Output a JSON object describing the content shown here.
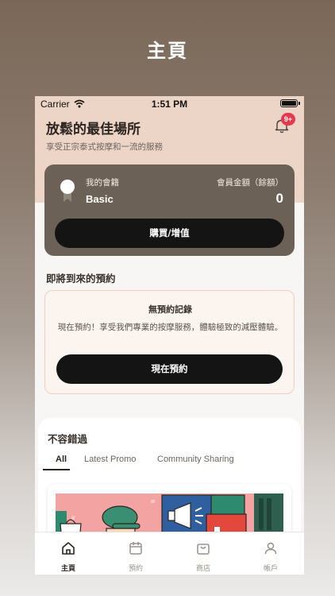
{
  "hero": {
    "title": "主頁"
  },
  "status_bar": {
    "carrier": "Carrier",
    "time": "1:51 PM"
  },
  "header": {
    "title": "放鬆的最佳場所",
    "subtitle": "享受正宗泰式按摩和一流的服務",
    "notification_badge": "9+"
  },
  "membership": {
    "label": "我的會籍",
    "tier": "Basic",
    "balance_label": "會員金額（餘額）",
    "balance_value": "0",
    "topup_button": "購買/增值"
  },
  "upcoming": {
    "heading": "即將到來的預約",
    "empty_title": "無預約記錄",
    "empty_description": "現在預約！享受我們專業的按摩服務，體驗極致的減壓體驗。",
    "book_button": "現在預約"
  },
  "promo": {
    "heading": "不容錯過",
    "tabs": [
      {
        "label": "All",
        "active": true
      },
      {
        "label": "Latest Promo",
        "active": false
      },
      {
        "label": "Community Sharing",
        "active": false
      }
    ]
  },
  "tab_bar": {
    "items": [
      {
        "label": "主頁",
        "icon": "home-icon",
        "active": true
      },
      {
        "label": "預約",
        "icon": "calendar-icon",
        "active": false
      },
      {
        "label": "商店",
        "icon": "shopping-bag-icon",
        "active": false
      },
      {
        "label": "帳戶",
        "icon": "person-icon",
        "active": false
      }
    ]
  },
  "colors": {
    "accent_dark": "#141414",
    "card_brown": "#6b6157",
    "header_pink": "#ecd4c6",
    "badge_red": "#e53a4b"
  }
}
